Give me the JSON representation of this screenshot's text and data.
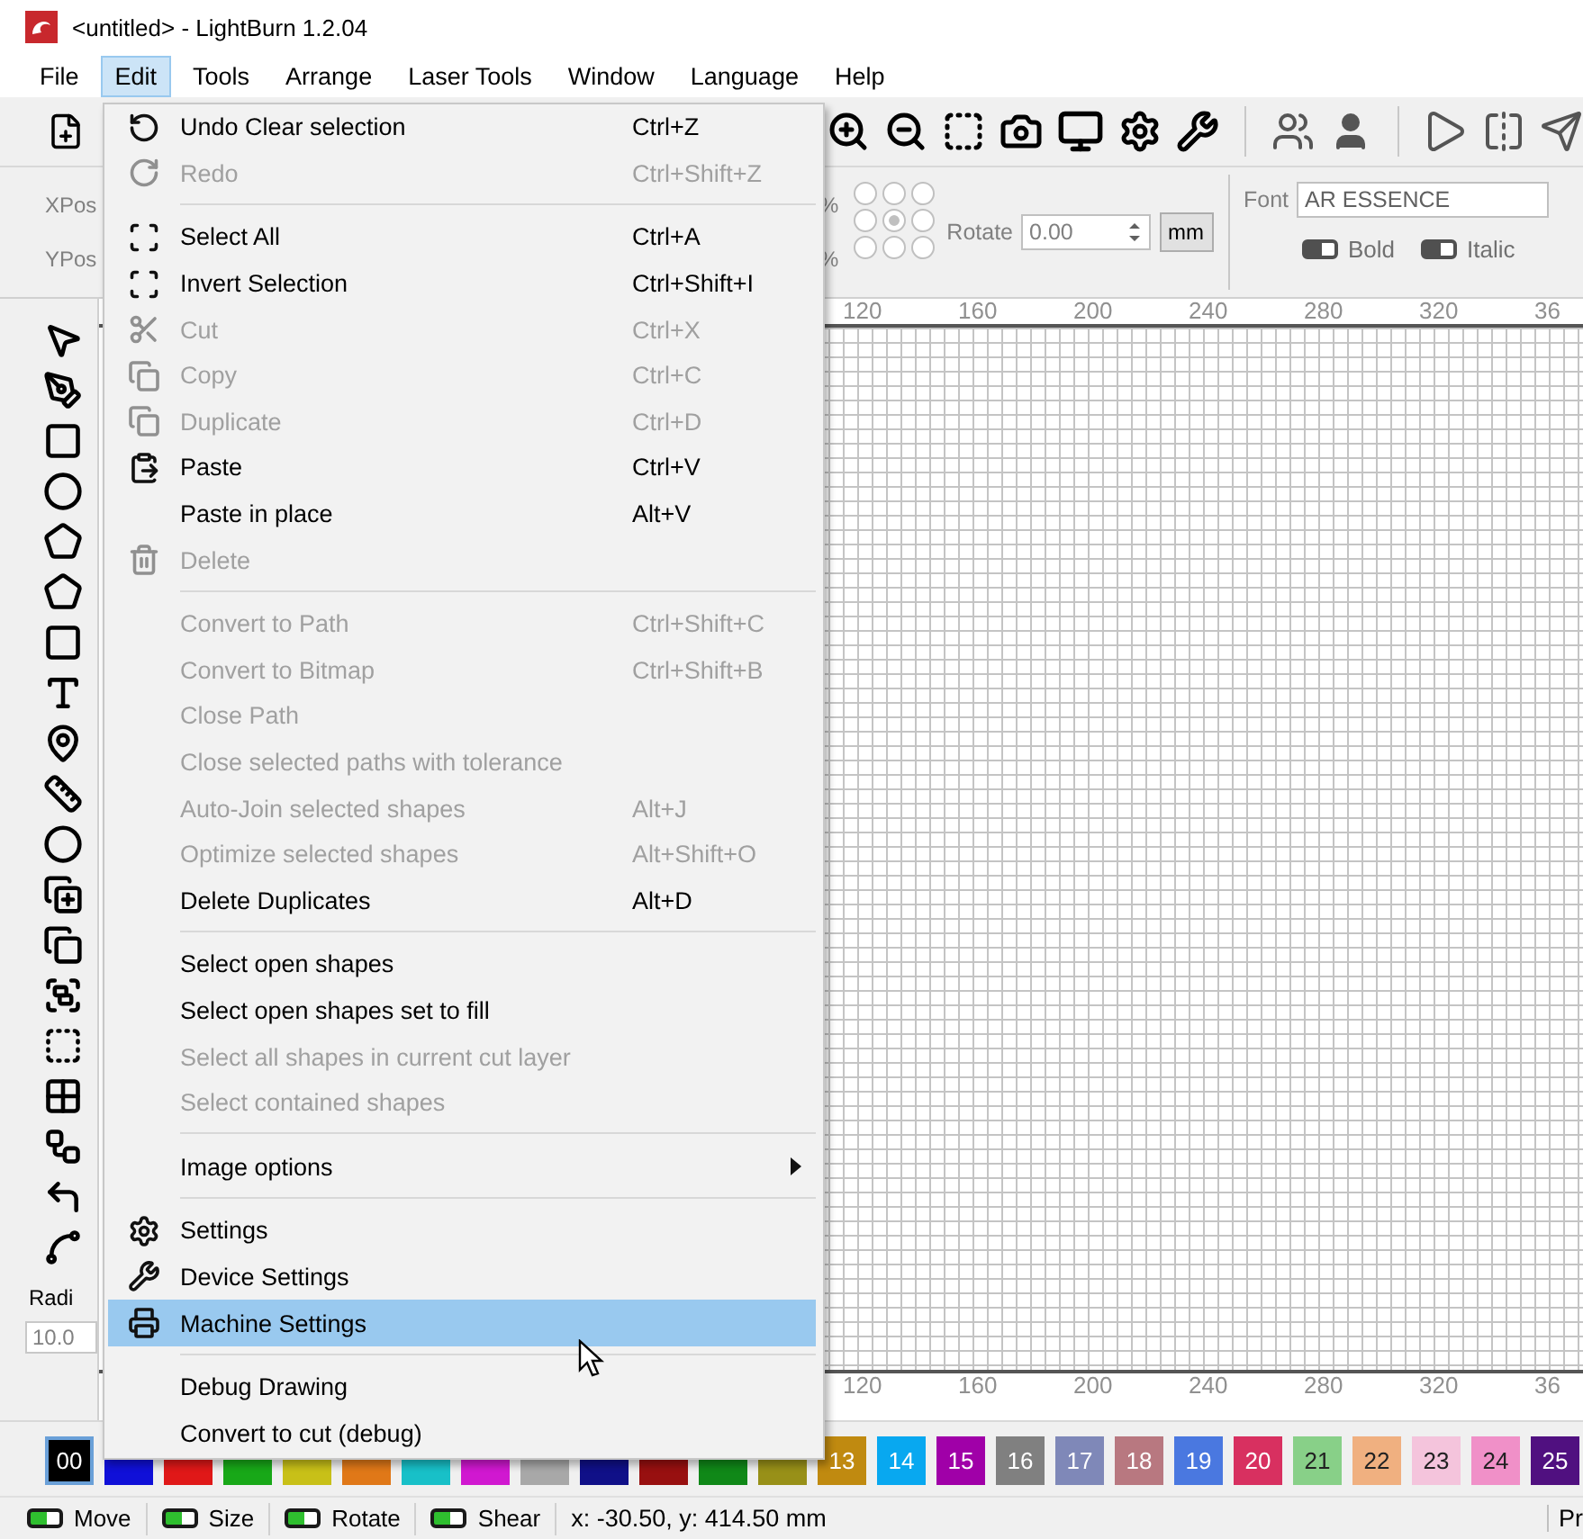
{
  "window": {
    "title": "<untitled> - LightBurn 1.2.04"
  },
  "menubar": [
    {
      "label": "File",
      "selected": false
    },
    {
      "label": "Edit",
      "selected": true
    },
    {
      "label": "Tools",
      "selected": false
    },
    {
      "label": "Arrange",
      "selected": false
    },
    {
      "label": "Laser Tools",
      "selected": false
    },
    {
      "label": "Window",
      "selected": false
    },
    {
      "label": "Language",
      "selected": false
    },
    {
      "label": "Help",
      "selected": false
    }
  ],
  "properties": {
    "xpos_label": "XPos",
    "ypos_label": "YPos",
    "percent_labels": [
      "%",
      "%"
    ],
    "anchor": [
      {
        "selected": false
      },
      {
        "selected": false
      },
      {
        "selected": false
      },
      {
        "selected": false
      },
      {
        "selected": true
      },
      {
        "selected": false
      },
      {
        "selected": false
      },
      {
        "selected": false
      },
      {
        "selected": false
      }
    ],
    "rotate_label": "Rotate",
    "rotate_value": "0.00",
    "unit_button": "mm",
    "font_label": "Font",
    "font_value": "AR ESSENCE",
    "toggles": [
      {
        "label": "Bold",
        "on": false
      },
      {
        "label": "Italic",
        "on": false
      }
    ]
  },
  "tools_panel": {
    "radius_label": "Radi",
    "radius_value": "10.0"
  },
  "canvas": {
    "top_ruler": [
      "120",
      "160",
      "200",
      "240",
      "280",
      "320",
      "36"
    ],
    "bottom_ruler": [
      "120",
      "160",
      "200",
      "240",
      "280",
      "320",
      "36"
    ]
  },
  "edit_menu": [
    {
      "kind": "item",
      "label": "Undo Clear selection",
      "shortcut": "Ctrl+Z",
      "disabled": false,
      "selected": false
    },
    {
      "kind": "item",
      "label": "Redo",
      "shortcut": "Ctrl+Shift+Z",
      "disabled": true,
      "selected": false
    },
    {
      "kind": "separator"
    },
    {
      "kind": "item",
      "label": "Select All",
      "shortcut": "Ctrl+A",
      "disabled": false,
      "selected": false
    },
    {
      "kind": "item",
      "label": "Invert Selection",
      "shortcut": "Ctrl+Shift+I",
      "disabled": false,
      "selected": false
    },
    {
      "kind": "item",
      "label": "Cut",
      "shortcut": "Ctrl+X",
      "disabled": true,
      "selected": false
    },
    {
      "kind": "item",
      "label": "Copy",
      "shortcut": "Ctrl+C",
      "disabled": true,
      "selected": false
    },
    {
      "kind": "item",
      "label": "Duplicate",
      "shortcut": "Ctrl+D",
      "disabled": true,
      "selected": false
    },
    {
      "kind": "item",
      "label": "Paste",
      "shortcut": "Ctrl+V",
      "disabled": false,
      "selected": false
    },
    {
      "kind": "item",
      "label": "Paste in place",
      "shortcut": "Alt+V",
      "disabled": false,
      "selected": false
    },
    {
      "kind": "item",
      "label": "Delete",
      "disabled": true,
      "selected": false
    },
    {
      "kind": "separator"
    },
    {
      "kind": "item",
      "label": "Convert to Path",
      "shortcut": "Ctrl+Shift+C",
      "disabled": true,
      "selected": false
    },
    {
      "kind": "item",
      "label": "Convert to Bitmap",
      "shortcut": "Ctrl+Shift+B",
      "disabled": true,
      "selected": false
    },
    {
      "kind": "item",
      "label": "Close Path",
      "disabled": true,
      "selected": false
    },
    {
      "kind": "item",
      "label": "Close selected paths with tolerance",
      "disabled": true,
      "selected": false
    },
    {
      "kind": "item",
      "label": "Auto-Join selected shapes",
      "shortcut": "Alt+J",
      "disabled": true,
      "selected": false
    },
    {
      "kind": "item",
      "label": "Optimize selected shapes",
      "shortcut": "Alt+Shift+O",
      "disabled": true,
      "selected": false
    },
    {
      "kind": "item",
      "label": "Delete Duplicates",
      "shortcut": "Alt+D",
      "disabled": false,
      "selected": false
    },
    {
      "kind": "separator"
    },
    {
      "kind": "item",
      "label": "Select open shapes",
      "disabled": false,
      "selected": false
    },
    {
      "kind": "item",
      "label": "Select open shapes set to fill",
      "disabled": false,
      "selected": false
    },
    {
      "kind": "item",
      "label": "Select all shapes in current cut layer",
      "disabled": true,
      "selected": false
    },
    {
      "kind": "item",
      "label": "Select contained shapes",
      "disabled": true,
      "selected": false
    },
    {
      "kind": "separator"
    },
    {
      "kind": "submenu",
      "label": "Image options",
      "disabled": false,
      "selected": false
    },
    {
      "kind": "separator"
    },
    {
      "kind": "item",
      "label": "Settings",
      "disabled": false,
      "selected": false
    },
    {
      "kind": "item",
      "label": "Device Settings",
      "disabled": false,
      "selected": false
    },
    {
      "kind": "item",
      "label": "Machine Settings",
      "disabled": false,
      "selected": true
    },
    {
      "kind": "separator"
    },
    {
      "kind": "item",
      "label": "Debug Drawing",
      "disabled": false,
      "selected": false
    },
    {
      "kind": "item",
      "label": "Convert to cut (debug)",
      "disabled": false,
      "selected": false
    }
  ],
  "palette": [
    {
      "label": "00",
      "color": "#000000",
      "selected": true
    },
    {
      "color": "#1010d8",
      "selected": false
    },
    {
      "color": "#e01818",
      "selected": false
    },
    {
      "color": "#18a818",
      "selected": false
    },
    {
      "color": "#c8c018",
      "selected": false
    },
    {
      "color": "#e07818",
      "selected": false
    },
    {
      "color": "#18c0c8",
      "selected": false
    },
    {
      "color": "#d018d0",
      "selected": false
    },
    {
      "color": "#a8a8a8",
      "selected": false
    },
    {
      "color": "#101088",
      "selected": false
    },
    {
      "color": "#981010",
      "selected": false
    },
    {
      "color": "#108818",
      "selected": false
    },
    {
      "color": "#989018",
      "selected": false
    },
    {
      "label": "13",
      "color": "#c08a10",
      "selected": false
    },
    {
      "label": "14",
      "color": "#08a8f0",
      "selected": false
    },
    {
      "label": "15",
      "color": "#a000a8",
      "selected": false
    },
    {
      "label": "16",
      "color": "#808080",
      "selected": false
    },
    {
      "label": "17",
      "color": "#7f88b8",
      "selected": false
    },
    {
      "label": "18",
      "color": "#b87880",
      "selected": false
    },
    {
      "label": "19",
      "color": "#4a78e0",
      "selected": false
    },
    {
      "label": "20",
      "color": "#d83060",
      "selected": false
    },
    {
      "label": "21",
      "color": "#88d088",
      "selected": false
    },
    {
      "label": "22",
      "color": "#f0b080",
      "selected": false
    },
    {
      "label": "23",
      "color": "#f4c4dc",
      "selected": false
    },
    {
      "label": "24",
      "color": "#f090c8",
      "selected": false
    },
    {
      "label": "25",
      "color": "#501080",
      "selected": false
    }
  ],
  "status_bar": {
    "toggles": [
      {
        "label": "Move",
        "on": true
      },
      {
        "label": "Size",
        "on": true
      },
      {
        "label": "Rotate",
        "on": true
      },
      {
        "label": "Shear",
        "on": true
      }
    ],
    "coordinates": "x: -30.50, y: 414.50 mm",
    "right_text": "Pr"
  }
}
